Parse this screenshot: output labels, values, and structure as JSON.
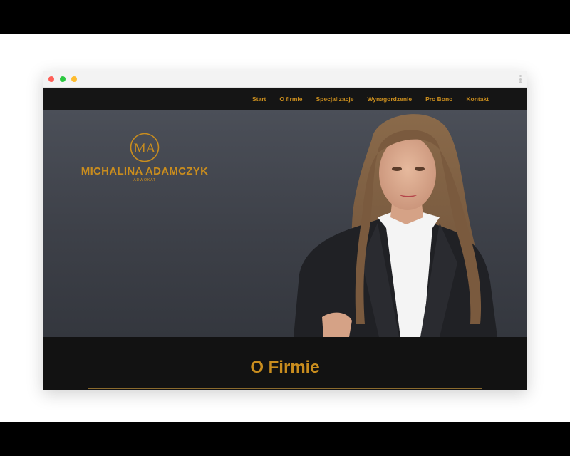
{
  "window": {
    "controls": [
      "close",
      "minimize",
      "maximize"
    ]
  },
  "nav": {
    "items": [
      {
        "label": "Start"
      },
      {
        "label": "O firmie"
      },
      {
        "label": "Specjalizacje"
      },
      {
        "label": "Wynagordzenie"
      },
      {
        "label": "Pro Bono"
      },
      {
        "label": "Kontakt"
      }
    ]
  },
  "logo": {
    "monogram": "MA",
    "name": "MICHALINA ADAMCZYK",
    "subtitle": "ADWOKAT"
  },
  "section": {
    "title": "O Firmie"
  },
  "colors": {
    "accent": "#c98d1e",
    "navbar": "#151515",
    "hero_top": "#4b4f58",
    "section_bg": "#121212"
  }
}
